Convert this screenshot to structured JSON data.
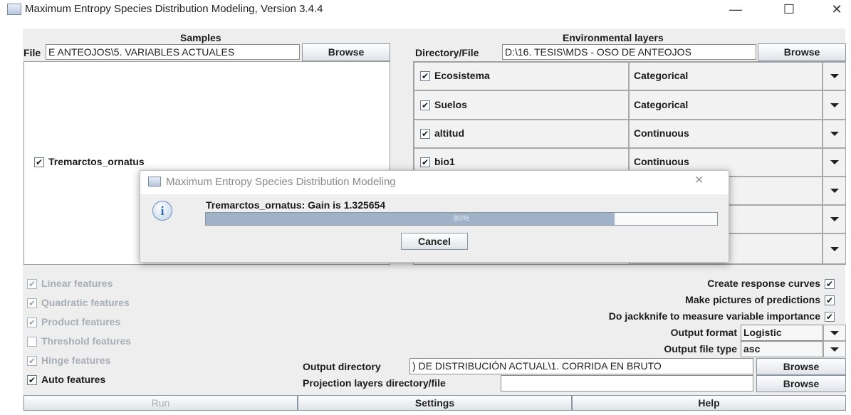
{
  "window": {
    "title": "Maximum Entropy Species Distribution Modeling, Version 3.4.4",
    "minimize": "—",
    "maximize": "☐",
    "close": "✕"
  },
  "samples": {
    "heading": "Samples",
    "file_label": "File",
    "file_value": "E ANTEOJOS\\5. VARIABLES ACTUALES",
    "browse": "Browse",
    "species": "Tremarctos_ornatus"
  },
  "environment": {
    "heading": "Environmental layers",
    "dir_label": "Directory/File",
    "dir_value": "D:\\16. TESIS\\MDS - OSO DE ANTEOJOS",
    "browse": "Browse",
    "layers": [
      {
        "name": "Ecosistema",
        "type": "Categorical"
      },
      {
        "name": "Suelos",
        "type": "Categorical"
      },
      {
        "name": "altitud",
        "type": "Continuous"
      },
      {
        "name": "bio1",
        "type": "Continuous"
      }
    ]
  },
  "features": {
    "linear": "Linear features",
    "quadratic": "Quadratic features",
    "product": "Product features",
    "threshold": "Threshold features",
    "hinge": "Hinge features",
    "auto": "Auto features"
  },
  "options": {
    "response_curves": "Create response curves",
    "pictures": "Make pictures of predictions",
    "jackknife": "Do jackknife to measure variable importance",
    "output_format_label": "Output format",
    "output_format_value": "Logistic",
    "output_type_label": "Output file type",
    "output_type_value": "asc",
    "output_dir_label": "Output directory",
    "output_dir_value": ") DE DISTRIBUCIÓN ACTUAL\\1. CORRIDA EN BRUTO",
    "output_browse": "Browse",
    "projection_label": "Projection layers directory/file",
    "projection_value": "",
    "projection_browse": "Browse"
  },
  "bottom": {
    "run": "Run",
    "settings": "Settings",
    "help": "Help"
  },
  "dialog": {
    "title": "Maximum Entropy Species Distribution Modeling",
    "close": "✕",
    "info_icon": "i",
    "message": "Tremarctos_ornatus: Gain is 1.325654",
    "progress_value": 0.8,
    "progress_text": "80%",
    "cancel": "Cancel"
  },
  "colors": {
    "progress_fill": "#9fb2c8",
    "disabled_text": "#a7aeb7"
  },
  "check_glyph": "✔"
}
